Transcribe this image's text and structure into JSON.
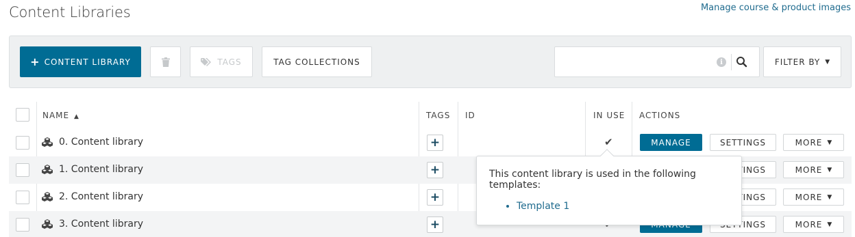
{
  "page": {
    "title": "Content Libraries",
    "top_link": "Manage course & product images"
  },
  "toolbar": {
    "add_label": "CONTENT LIBRARY",
    "tags_label": "TAGS",
    "tag_collections_label": "TAG COLLECTIONS",
    "search_value": "",
    "search_placeholder": "",
    "filter_label": "FILTER BY"
  },
  "table": {
    "headers": {
      "name": "NAME",
      "tags": "TAGS",
      "id": "ID",
      "in_use": "IN USE",
      "actions": "ACTIONS"
    },
    "sort_indicator": "▲",
    "rows": [
      {
        "name": "0. Content library",
        "id": "",
        "in_use": true
      },
      {
        "name": "1. Content library",
        "id": "",
        "in_use": true
      },
      {
        "name": "2. Content library",
        "id": "",
        "in_use": true
      },
      {
        "name": "3. Content library",
        "id": "",
        "in_use": true
      }
    ],
    "action_labels": {
      "manage": "MANAGE",
      "settings": "SETTINGS",
      "more": "MORE"
    }
  },
  "popover": {
    "message": "This content library is used in the following templates:",
    "items": [
      "Template 1"
    ]
  },
  "colors": {
    "primary": "#006c94",
    "link": "#1f6b8e",
    "toolbar_bg": "#eef0f1"
  },
  "icons": {
    "add": "plus-icon",
    "delete": "trash-icon",
    "tags": "tag-icon",
    "info": "info-icon",
    "search": "search-icon",
    "library": "cubes-icon",
    "in_use": "check-icon",
    "dropdown": "caret-down-icon"
  }
}
